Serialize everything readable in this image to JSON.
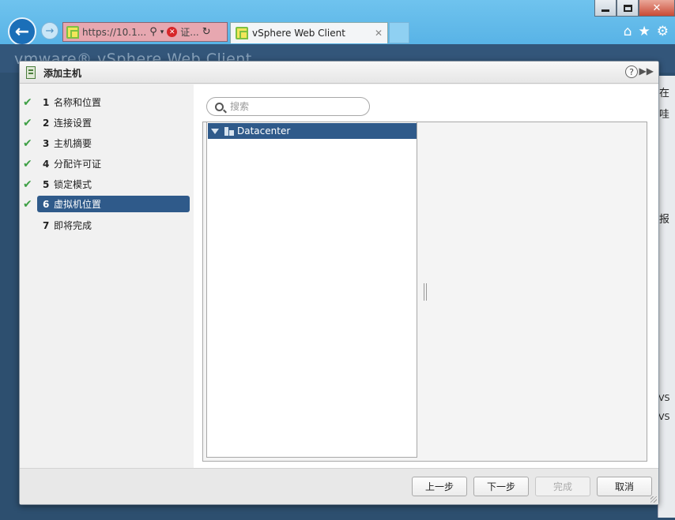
{
  "browser": {
    "address_url": "https://10.1...",
    "cert_label": "证...",
    "tab_title": "vSphere Web Client",
    "icons": [
      "back-icon",
      "forward-icon",
      "search-icon",
      "dropdown-icon",
      "cert-error-icon",
      "refresh-icon",
      "home-icon",
      "star-icon",
      "gear-icon"
    ]
  },
  "page": {
    "header_title": "vmware® vSphere Web Client",
    "right_fragments": [
      "在",
      "哇",
      "报",
      "VS",
      "VS"
    ]
  },
  "dialog": {
    "title": "添加主机",
    "steps": [
      {
        "num": "1",
        "label": "名称和位置",
        "done": true,
        "active": false
      },
      {
        "num": "2",
        "label": "连接设置",
        "done": true,
        "active": false
      },
      {
        "num": "3",
        "label": "主机摘要",
        "done": true,
        "active": false
      },
      {
        "num": "4",
        "label": "分配许可证",
        "done": true,
        "active": false
      },
      {
        "num": "5",
        "label": "锁定模式",
        "done": true,
        "active": false
      },
      {
        "num": "6",
        "label": "虚拟机位置",
        "done": true,
        "active": true
      },
      {
        "num": "7",
        "label": "即将完成",
        "done": false,
        "active": false
      }
    ],
    "search": {
      "placeholder": "搜索",
      "value": ""
    },
    "tree": {
      "items": [
        {
          "label": "Datacenter",
          "expanded": true,
          "selected": true
        }
      ]
    },
    "buttons": {
      "back": "上一步",
      "next": "下一步",
      "finish": "完成",
      "cancel": "取消"
    }
  },
  "colors": {
    "selection": "#2f5a8a",
    "check": "#3fa046",
    "chrome": "#6fc3ee"
  }
}
